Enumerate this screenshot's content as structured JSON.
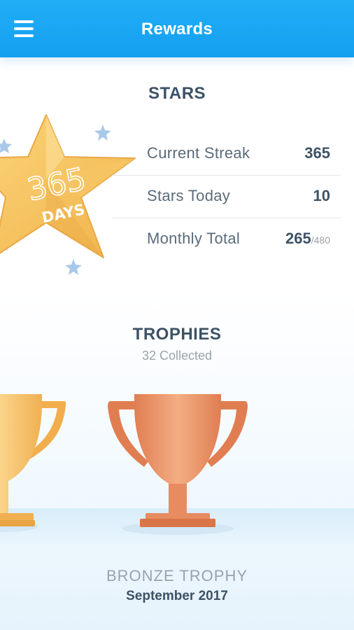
{
  "header": {
    "title": "Rewards"
  },
  "stars": {
    "title": "STARS",
    "badge": {
      "number": "365",
      "unit": "DAYS"
    },
    "rows": [
      {
        "label": "Current Streak",
        "value": "365",
        "denominator": ""
      },
      {
        "label": "Stars Today",
        "value": "10",
        "denominator": ""
      },
      {
        "label": "Monthly Total",
        "value": "265",
        "denominator": "/480"
      }
    ]
  },
  "trophies": {
    "title": "TROPHIES",
    "subtitle": "32 Collected",
    "selected": {
      "name": "BRONZE TROPHY",
      "date": "September 2017"
    }
  },
  "colors": {
    "header": "#1aa7f3",
    "gold": "#f5c15a",
    "bronze": "#e8956a",
    "text_dark": "#3d5266"
  },
  "icons": [
    "menu-icon",
    "star-badge-icon",
    "small-star-icon",
    "gold-trophy-icon",
    "bronze-trophy-icon"
  ]
}
